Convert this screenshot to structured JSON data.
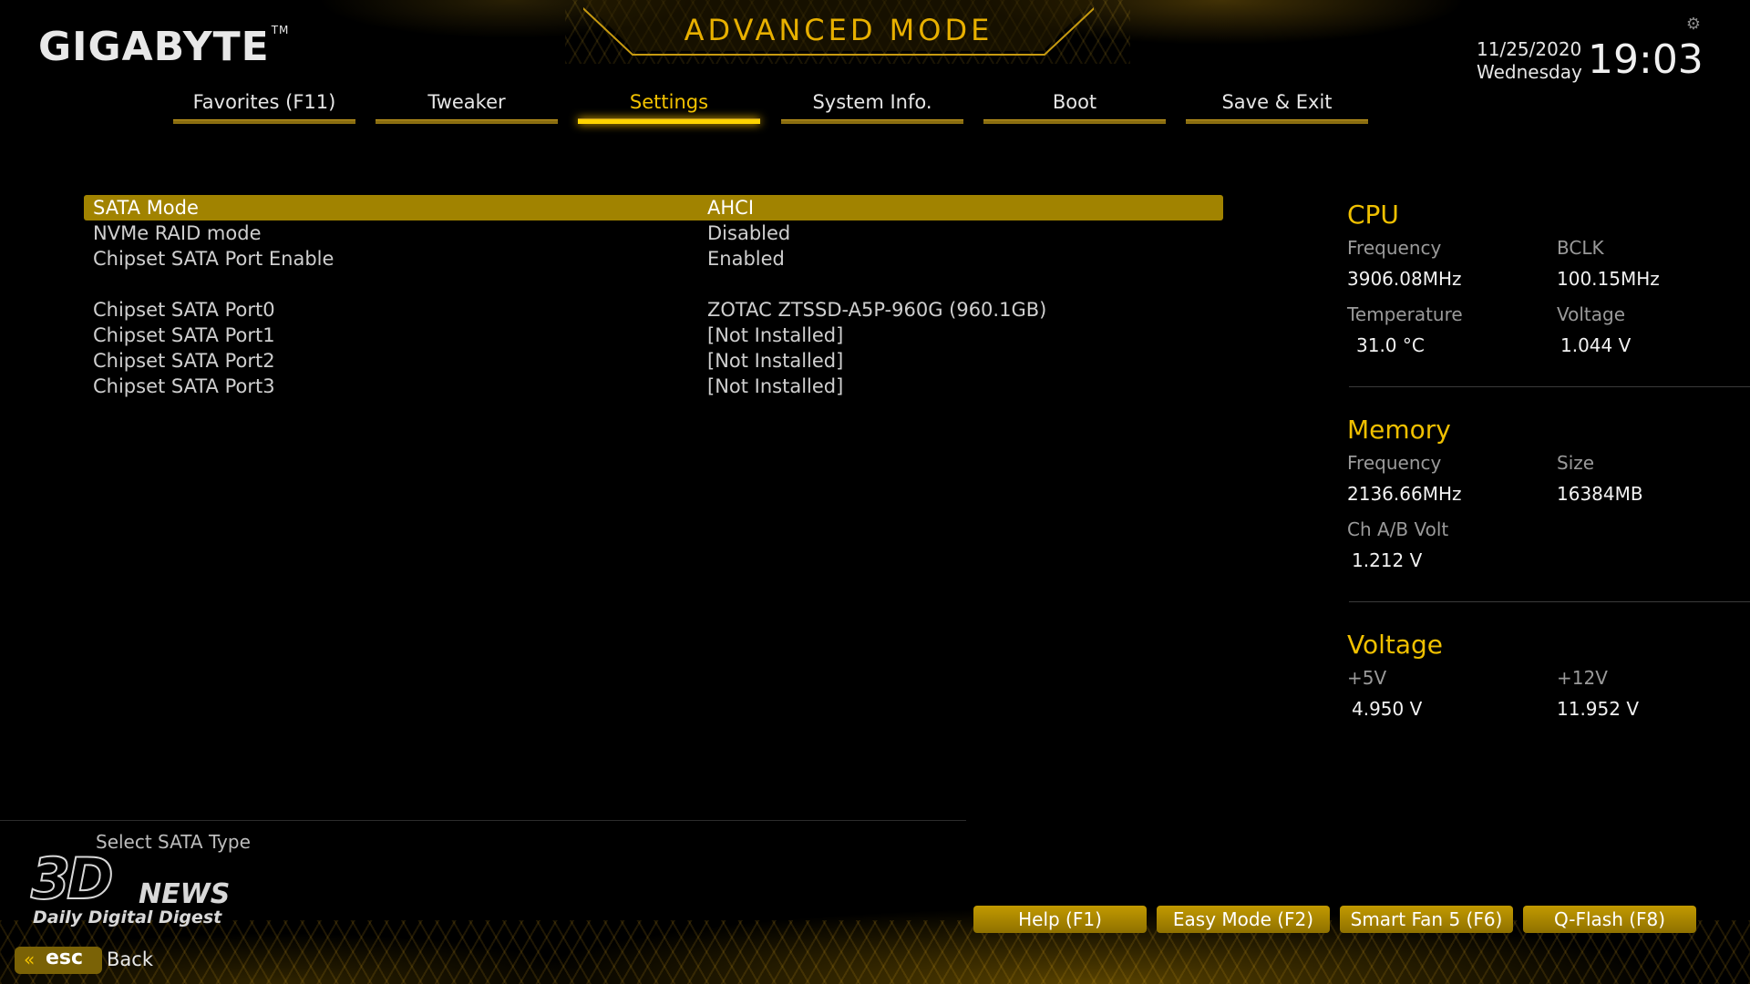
{
  "header": {
    "brand": "GIGABYTE",
    "brand_tm": "TM",
    "mode_title": "ADVANCED MODE",
    "date": "11/25/2020",
    "day": "Wednesday",
    "time": "19:03",
    "icons": {
      "settings": "gear-icon"
    }
  },
  "tabs": [
    {
      "label": "Favorites (F11)",
      "active": false
    },
    {
      "label": "Tweaker",
      "active": false
    },
    {
      "label": "Settings",
      "active": true
    },
    {
      "label": "System Info.",
      "active": false
    },
    {
      "label": "Boot",
      "active": false
    },
    {
      "label": "Save & Exit",
      "active": false
    }
  ],
  "settings": {
    "rows": [
      {
        "name": "SATA Mode",
        "value": "AHCI",
        "selected": true
      },
      {
        "name": "NVMe RAID mode",
        "value": "Disabled"
      },
      {
        "name": "Chipset SATA Port Enable",
        "value": "Enabled"
      },
      {
        "name": "Chipset SATA Port0",
        "value": "ZOTAC ZTSSD-A5P-960G (960.1GB)"
      },
      {
        "name": "Chipset SATA Port1",
        "value": "[Not Installed]"
      },
      {
        "name": "Chipset SATA Port2",
        "value": "[Not Installed]"
      },
      {
        "name": "Chipset SATA Port3",
        "value": "[Not Installed]"
      }
    ]
  },
  "info": {
    "cpu": {
      "title": "CPU",
      "frequency_label": "Frequency",
      "frequency": "3906.08MHz",
      "bclk_label": "BCLK",
      "bclk": "100.15MHz",
      "temperature_label": "Temperature",
      "temperature": "31.0 °C",
      "voltage_label": "Voltage",
      "voltage": "1.044 V"
    },
    "memory": {
      "title": "Memory",
      "frequency_label": "Frequency",
      "frequency": "2136.66MHz",
      "size_label": "Size",
      "size": "16384MB",
      "chab_label": "Ch A/B Volt",
      "chab": "1.212 V"
    },
    "voltage": {
      "title": "Voltage",
      "v5_label": "+5V",
      "v5": "4.950 V",
      "v12_label": "+12V",
      "v12": "11.952 V"
    }
  },
  "help_text": "Select SATA Type",
  "watermark": {
    "logo": "3D",
    "news": "NEWS",
    "tagline": "Daily Digital Digest"
  },
  "function_buttons": [
    {
      "label": "Help (F1)"
    },
    {
      "label": "Easy Mode (F2)"
    },
    {
      "label": "Smart Fan 5 (F6)"
    },
    {
      "label": "Q-Flash (F8)"
    }
  ],
  "esc": {
    "key": "esc",
    "label": "Back"
  },
  "colors": {
    "accent": "#f2c200",
    "selected_row": "#a18300",
    "button": "#b08c00"
  }
}
